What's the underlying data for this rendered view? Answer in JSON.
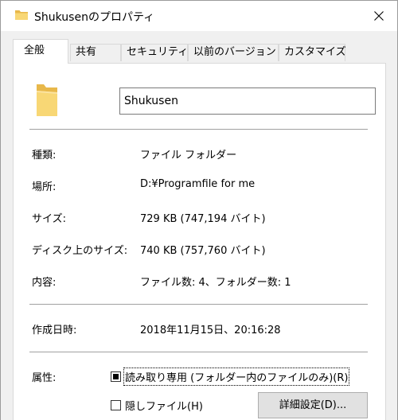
{
  "window": {
    "title": "Shukusenのプロパティ"
  },
  "tabs": [
    {
      "label": "全般",
      "active": true
    },
    {
      "label": "共有",
      "active": false
    },
    {
      "label": "セキュリティ",
      "active": false
    },
    {
      "label": "以前のバージョン",
      "active": false
    },
    {
      "label": "カスタマイズ",
      "active": false
    }
  ],
  "general": {
    "folder_name": "Shukusen",
    "rows": [
      {
        "label": "種類:",
        "value": "ファイル フォルダー"
      },
      {
        "label": "場所:",
        "value": "D:¥Programfile for me"
      },
      {
        "label": "サイズ:",
        "value": "729 KB (747,194 バイト)"
      },
      {
        "label": "ディスク上のサイズ:",
        "value": "740 KB (757,760 バイト)"
      },
      {
        "label": "内容:",
        "value": "ファイル数: 4、フォルダー数: 1"
      }
    ],
    "created_label": "作成日時:",
    "created_value": "2018年11月15日、20:16:28",
    "attributes_label": "属性:",
    "readonly_label": "読み取り専用 (フォルダー内のファイルのみ)(R)",
    "readonly_state": "indeterminate",
    "hidden_label": "隠しファイル(H)",
    "hidden_checked": false,
    "advanced_button": "詳細設定(D)..."
  },
  "colors": {
    "folder_yellow": "#f8d775",
    "folder_dark": "#e8b84a"
  }
}
